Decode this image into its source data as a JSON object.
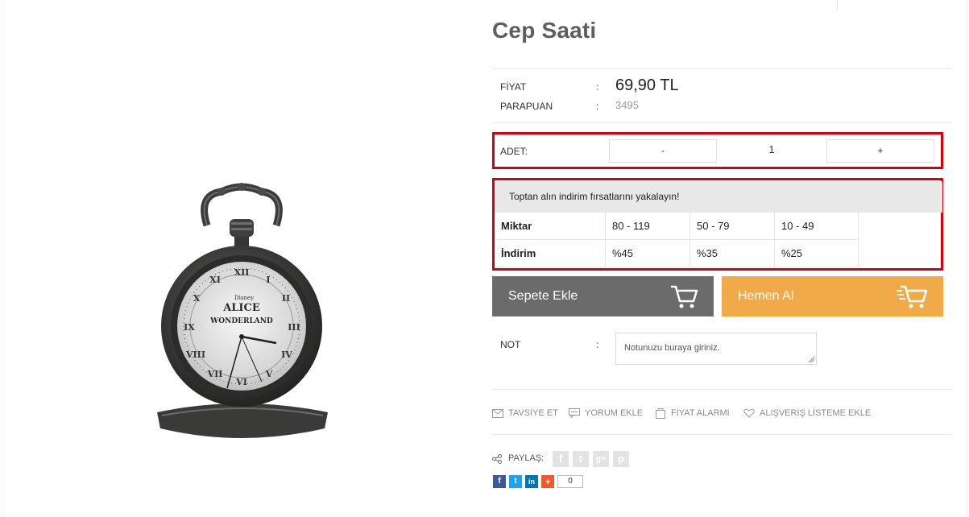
{
  "product": {
    "title": "Cep Saati"
  },
  "info": {
    "price_label": "FİYAT",
    "price_value": "69,90 TL",
    "points_label": "PARAPUAN",
    "points_value": "3495",
    "colon": ":"
  },
  "quantity": {
    "label": "ADET:",
    "minus": "-",
    "value": "1",
    "plus": "+"
  },
  "wholesale": {
    "heading": "Toptan alın indirim fırsatlarını yakalayın!",
    "row_labels": [
      "Miktar",
      "İndirim"
    ],
    "quantities": [
      "80 - 119",
      "50 - 79",
      "10 - 49"
    ],
    "discounts": [
      "%45",
      "%35",
      "%25"
    ]
  },
  "buttons": {
    "add_to_cart": "Sepete Ekle",
    "buy_now": "Hemen Al",
    "cart_icon": "cart-icon",
    "fast_cart_icon": "fast-cart-icon"
  },
  "note": {
    "label": "NOT",
    "placeholder": "Notunuzu buraya giriniz."
  },
  "actions": {
    "recommend": "TAVSİYE ET",
    "comment": "YORUM EKLE",
    "price_alarm": "FİYAT ALARMI",
    "wishlist": "ALIŞVERİŞ LİSTEME EKLE"
  },
  "share": {
    "label": "PAYLAŞ:",
    "networks": [
      "facebook",
      "twitter",
      "google-plus",
      "pinterest"
    ],
    "count": "0"
  },
  "image_art": {
    "brand": "Disney",
    "line1": "ALICE",
    "line2": "WONDERLAND"
  },
  "colors": {
    "cart_button": "#6b6b6b",
    "buy_button": "#f0aa47",
    "highlight": "#d8000c"
  }
}
